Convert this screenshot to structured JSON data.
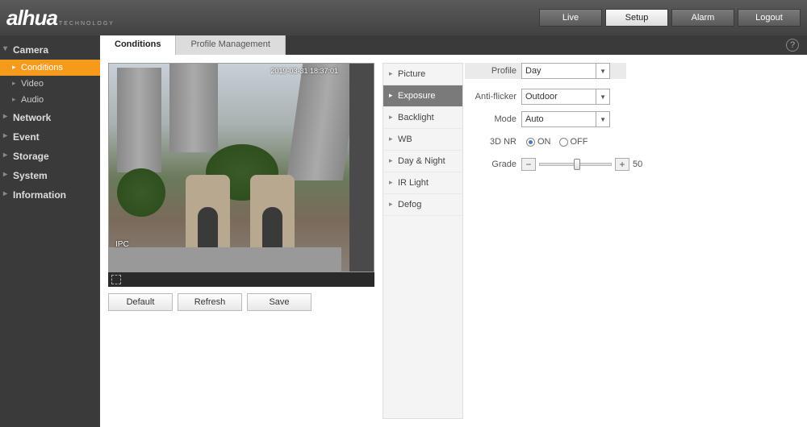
{
  "brand": "alhua",
  "brand_sub": "TECHNOLOGY",
  "header_tabs": {
    "live": "Live",
    "setup": "Setup",
    "alarm": "Alarm",
    "logout": "Logout"
  },
  "sidebar": {
    "camera": "Camera",
    "camera_items": {
      "conditions": "Conditions",
      "video": "Video",
      "audio": "Audio"
    },
    "network": "Network",
    "event": "Event",
    "storage": "Storage",
    "system": "System",
    "information": "Information"
  },
  "tabs": {
    "conditions": "Conditions",
    "profile_mgmt": "Profile Management"
  },
  "preview": {
    "timestamp": "2019-03-31 18:37:01",
    "channel": "IPC"
  },
  "buttons": {
    "default": "Default",
    "refresh": "Refresh",
    "save": "Save"
  },
  "submenu": {
    "picture": "Picture",
    "exposure": "Exposure",
    "backlight": "Backlight",
    "wb": "WB",
    "day_night": "Day & Night",
    "ir_light": "IR Light",
    "defog": "Defog"
  },
  "settings": {
    "profile_label": "Profile",
    "profile_value": "Day",
    "anti_flicker_label": "Anti-flicker",
    "anti_flicker_value": "Outdoor",
    "mode_label": "Mode",
    "mode_value": "Auto",
    "nr_label": "3D NR",
    "nr_on": "ON",
    "nr_off": "OFF",
    "grade_label": "Grade",
    "grade_value": "50"
  }
}
